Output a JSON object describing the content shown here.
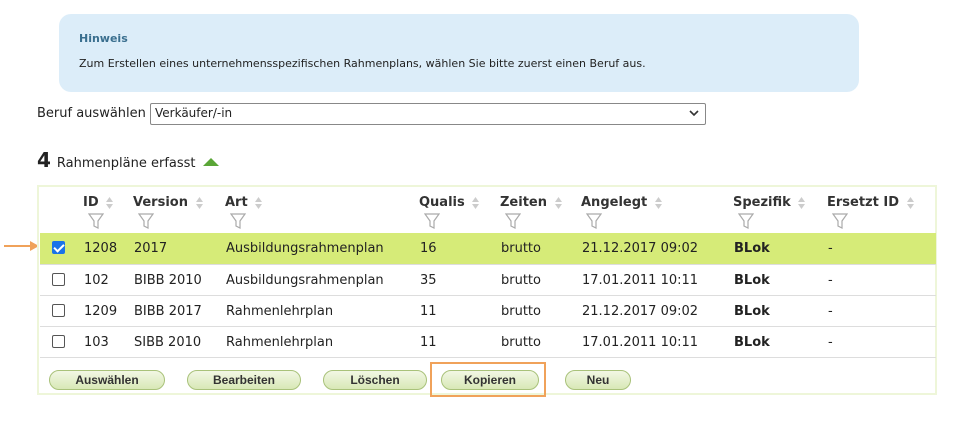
{
  "notice": {
    "title": "Hinweis",
    "text": "Zum Erstellen eines unternehmensspezifischen Rahmenplans, wählen Sie bitte zuerst einen Beruf aus."
  },
  "beruf": {
    "label": "Beruf auswählen",
    "selected": "Verkäufer/-in"
  },
  "summary": {
    "count": "4",
    "label": "Rahmenpläne erfasst"
  },
  "table": {
    "headers": {
      "id": "ID",
      "version": "Version",
      "art": "Art",
      "qualis": "Qualis",
      "zeiten": "Zeiten",
      "angelegt": "Angelegt",
      "spezifik": "Spezifik",
      "ersetzt": "Ersetzt ID"
    },
    "rows": [
      {
        "checked": true,
        "id": "1208",
        "version": "2017",
        "art": "Ausbildungsrahmenplan",
        "qualis": "16",
        "zeiten": "brutto",
        "angelegt": "21.12.2017 09:02",
        "spezifik": "BLok",
        "ersetzt": "-"
      },
      {
        "checked": false,
        "id": "102",
        "version": "BIBB 2010",
        "art": "Ausbildungsrahmenplan",
        "qualis": "35",
        "zeiten": "brutto",
        "angelegt": "17.01.2011 10:11",
        "spezifik": "BLok",
        "ersetzt": "-"
      },
      {
        "checked": false,
        "id": "1209",
        "version": "BIBB 2017",
        "art": "Rahmenlehrplan",
        "qualis": "11",
        "zeiten": "brutto",
        "angelegt": "21.12.2017 09:02",
        "spezifik": "BLok",
        "ersetzt": "-"
      },
      {
        "checked": false,
        "id": "103",
        "version": "SIBB 2010",
        "art": "Rahmenlehrplan",
        "qualis": "11",
        "zeiten": "brutto",
        "angelegt": "17.01.2011 10:11",
        "spezifik": "BLok",
        "ersetzt": "-"
      }
    ]
  },
  "actions": {
    "select": "Auswählen",
    "edit": "Bearbeiten",
    "delete": "Löschen",
    "copy": "Kopieren",
    "new": "Neu"
  },
  "colors": {
    "selected_row": "#d6eb78",
    "highlight": "#f0a25a",
    "notice_bg": "#dcedf9"
  }
}
